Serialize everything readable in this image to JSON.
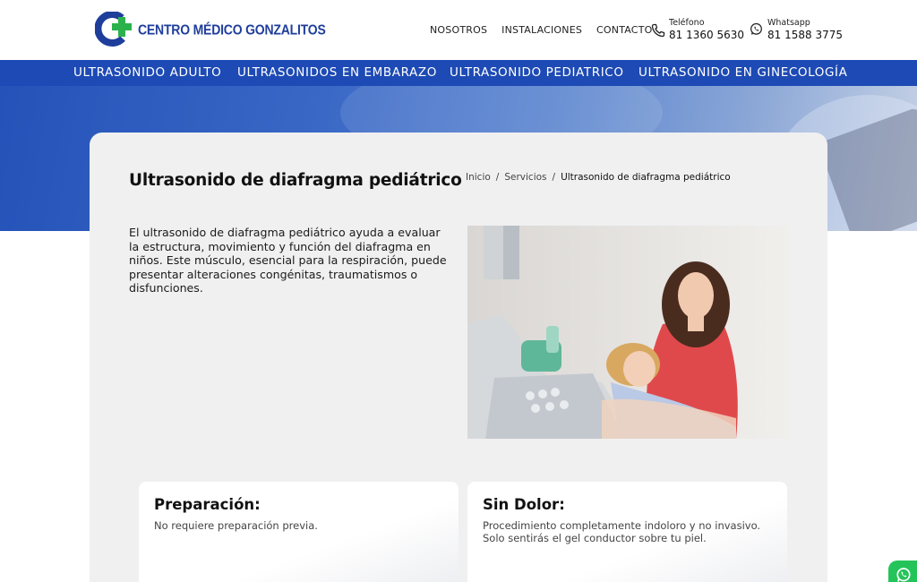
{
  "brand": {
    "name": "CENTRO MÉDICO GONZALITOS"
  },
  "nav": {
    "items": [
      "NOSOTROS",
      "INSTALACIONES",
      "CONTACTO"
    ]
  },
  "contacts": [
    {
      "label": "Teléfono",
      "number": "81 1360 5630",
      "icon": "phone-icon"
    },
    {
      "label": "Whatsapp",
      "number": "81 1588 3775",
      "icon": "whatsapp-icon"
    }
  ],
  "services": [
    "ULTRASONIDO ADULTO",
    "ULTRASONIDOS EN EMBARAZO",
    "ULTRASONIDO PEDIATRICO",
    "ULTRASONIDO EN GINECOLOGÍA"
  ],
  "page": {
    "title": "Ultrasonido de diafragma pediátrico",
    "breadcrumb": [
      "Inicio",
      "Servicios",
      "Ultrasonido de diafragma pediátrico"
    ],
    "breadcrumb_sep": "/",
    "intro": "El ultrasonido de diafragma pediátrico ayuda a evaluar la estructura, movimiento y función del diafragma en niños. Este músculo, esencial para la respiración, puede presentar alteraciones congénitas, traumatismos o disfunciones."
  },
  "info_cards": [
    {
      "title": "Preparación:",
      "text": "No requiere preparación previa."
    },
    {
      "title": "Sin Dolor:",
      "text": "Procedimiento completamente indoloro y no invasivo. Solo sentirás el gel conductor sobre tu piel."
    }
  ],
  "colors": {
    "brand_blue": "#1d4ab4",
    "logo_blue": "#1f3e9c",
    "logo_green": "#2bb24c",
    "whatsapp_green": "#25c45a",
    "card_bg": "#f0f0f1"
  }
}
